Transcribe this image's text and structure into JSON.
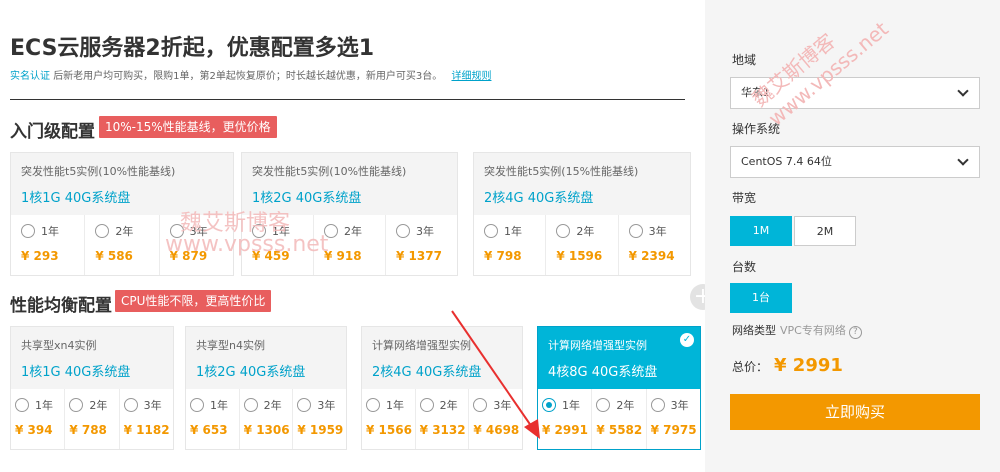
{
  "header": {
    "title": "ECS云服务器2折起，优惠配置多选1",
    "notice_link": "实名认证",
    "notice_text": "后新老用户均可购买，限购1单，第2单起恢复原价；时长越长越优惠，新用户可买3台。",
    "rules_link": "详细规则"
  },
  "entry": {
    "title": "入门级配置",
    "tag": "10%-15%性能基线，更优价格",
    "cards": [
      {
        "type": "突发性能t5实例(10%性能基线)",
        "spec": "1核1G 40G系统盘",
        "options": [
          {
            "year": "1年",
            "price": "¥ 293"
          },
          {
            "year": "2年",
            "price": "¥ 586"
          },
          {
            "year": "3年",
            "price": "¥ 879"
          }
        ]
      },
      {
        "type": "突发性能t5实例(10%性能基线)",
        "spec": "1核2G 40G系统盘",
        "options": [
          {
            "year": "1年",
            "price": "¥ 459"
          },
          {
            "year": "2年",
            "price": "¥ 918"
          },
          {
            "year": "3年",
            "price": "¥ 1377"
          }
        ]
      },
      {
        "type": "突发性能t5实例(15%性能基线)",
        "spec": "2核4G 40G系统盘",
        "options": [
          {
            "year": "1年",
            "price": "¥ 798"
          },
          {
            "year": "2年",
            "price": "¥ 1596"
          },
          {
            "year": "3年",
            "price": "¥ 2394"
          }
        ]
      }
    ]
  },
  "balanced": {
    "title": "性能均衡配置",
    "tag": "CPU性能不限，更高性价比",
    "cards": [
      {
        "type": "共享型xn4实例",
        "spec": "1核1G 40G系统盘",
        "options": [
          {
            "year": "1年",
            "price": "¥ 394"
          },
          {
            "year": "2年",
            "price": "¥ 788"
          },
          {
            "year": "3年",
            "price": "¥ 1182"
          }
        ]
      },
      {
        "type": "共享型n4实例",
        "spec": "1核2G 40G系统盘",
        "options": [
          {
            "year": "1年",
            "price": "¥ 653"
          },
          {
            "year": "2年",
            "price": "¥ 1306"
          },
          {
            "year": "3年",
            "price": "¥ 1959"
          }
        ]
      },
      {
        "type": "计算网络增强型实例",
        "spec": "2核4G 40G系统盘",
        "options": [
          {
            "year": "1年",
            "price": "¥ 1566"
          },
          {
            "year": "2年",
            "price": "¥ 3132"
          },
          {
            "year": "3年",
            "price": "¥ 4698"
          }
        ]
      },
      {
        "type": "计算网络增强型实例",
        "spec": "4核8G 40G系统盘",
        "options": [
          {
            "year": "1年",
            "price": "¥ 2991"
          },
          {
            "year": "2年",
            "price": "¥ 5582"
          },
          {
            "year": "3年",
            "price": "¥ 7975"
          }
        ]
      }
    ]
  },
  "sidebar": {
    "region_label": "地域",
    "region_value": "华东1",
    "os_label": "操作系统",
    "os_value": "CentOS 7.4 64位",
    "bandwidth_label": "带宽",
    "bandwidth_options": [
      "1M",
      "2M"
    ],
    "count_label": "台数",
    "count_value": "1台",
    "network_label": "网络类型",
    "network_value": "VPC专有网络",
    "help_glyph": "?",
    "total_label": "总价：",
    "total_value": "¥ 2991",
    "buy_label": "立即购买"
  },
  "watermark": {
    "cn": "魏艾斯博客",
    "url": "www.vpsss.net"
  },
  "icons": {
    "plus_glyph": "+",
    "check_glyph": "✓"
  },
  "colors": {
    "accent": "#00a2ca",
    "price": "#f39800",
    "tag": "#e85e5e",
    "buy": "#f39800"
  }
}
